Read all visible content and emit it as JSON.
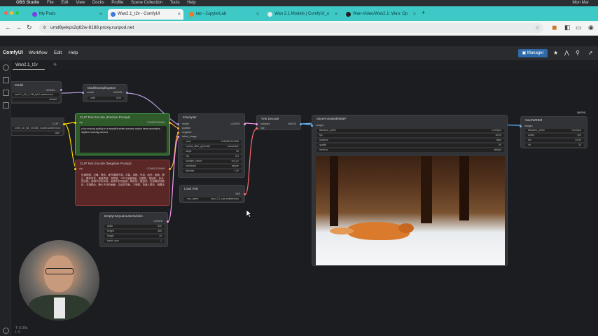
{
  "menubar": {
    "app": "OBS Studio",
    "items": [
      "File",
      "Edit",
      "View",
      "Docks",
      "Profile",
      "Scene Collection",
      "Tools",
      "Help"
    ],
    "clock": "Mon Mar"
  },
  "browser": {
    "tabs": [
      {
        "label": "My Pods",
        "active": false
      },
      {
        "label": "Wan2.1_t2v - ComfyUI",
        "active": true
      },
      {
        "label": "lab - JupyterLab",
        "active": false
      },
      {
        "label": "Wan 2.1 Models | ComfyUI_o",
        "active": false
      },
      {
        "label": "Wan-Video/Wan2.1: Wan: Op",
        "active": false
      }
    ],
    "new_tab": "+",
    "url": "umd8yekps2q62w-8188.proxy.runpod.net"
  },
  "comfy": {
    "logo": "ComfyUI",
    "menu": [
      "Workflow",
      "Edit",
      "Help"
    ],
    "manager_label": "Manager",
    "workflow_tab": "Wan2.1_t2v",
    "add_tab": "+"
  },
  "nodes": {
    "model_loader": {
      "title": "Model",
      "widget": "wan2.1_t2v_1.3B_fp16.safetensors",
      "dtype": "default",
      "out": "MODEL"
    },
    "sampling": {
      "title": "ModelSamplingSD3",
      "in": "model",
      "out": "MODEL",
      "shift_label": "shift",
      "shift_value": "8.00"
    },
    "clip_loader": {
      "title": "CLIP",
      "widget": "umt5_xxl_fp8_e4m3fn_scaled.safetensors",
      "type": "wan",
      "out": "CLIP"
    },
    "pos_prompt": {
      "title": "CLIP Text Encode (Positive Prompt)",
      "in": "clip",
      "out": "CONDITIONING",
      "text": "a fox moving quickly in a beautiful winter scenery nature trees mountains daytime tracking camera"
    },
    "neg_prompt": {
      "title": "CLIP Text Encode (Negative Prompt)",
      "in": "clip",
      "out": "CONDITIONING",
      "text": "色调艳丽，过曝，静态，细节模糊不清，字幕，风格，作品，画作，画面，静止，整体发灰，最差质量，低质量，JPEG压缩残留，丑陋的，残缺的，多余的手指，画得不好的手部，画得不好的脸部，畸形的，毁容的，形态畸形的肢体，手指融合，静止不动的画面，杂乱的背景，三条腿，背景人很多，倒着走"
    },
    "ksampler": {
      "title": "KSampler",
      "inputs": [
        "model",
        "positive",
        "negative",
        "latent_image"
      ],
      "out": "LATENT",
      "widgets": [
        {
          "label": "seed",
          "value": "1082826144288"
        },
        {
          "label": "control_after_generate",
          "value": "randomize"
        },
        {
          "label": "steps",
          "value": "30"
        },
        {
          "label": "cfg",
          "value": "6.0"
        },
        {
          "label": "sampler_name",
          "value": "uni_pc"
        },
        {
          "label": "scheduler",
          "value": "simple"
        },
        {
          "label": "denoise",
          "value": "1.00"
        }
      ]
    },
    "vae_decode": {
      "title": "VAE Decode",
      "inputs": [
        "samples",
        "vae"
      ],
      "out": "IMAGE"
    },
    "load_vae": {
      "title": "Load VAE",
      "out": "VAE",
      "widget_label": "vae_name",
      "widget_value": "wan_2.1_vae.safetensors"
    },
    "empty_latent": {
      "title": "EmptyHunyuanLatentVideo",
      "out": "LATENT",
      "widgets": [
        {
          "label": "width",
          "value": "832"
        },
        {
          "label": "height",
          "value": "480"
        },
        {
          "label": "length",
          "value": "33"
        },
        {
          "label": "batch_size",
          "value": "1"
        }
      ]
    },
    "save_animated": {
      "title": "SaveAnimatedWEBP",
      "in": "images",
      "widgets": [
        {
          "label": "filename_prefix",
          "value": "ComfyUI"
        },
        {
          "label": "fps",
          "value": "16.00"
        },
        {
          "label": "lossless",
          "value": "false"
        },
        {
          "label": "quality",
          "value": "90"
        },
        {
          "label": "method",
          "value": "default"
        }
      ]
    },
    "save_webm": {
      "title": "SaveWEBM",
      "badge": "[NEW]",
      "in": "images",
      "widgets": [
        {
          "label": "filename_prefix",
          "value": "ComfyUI"
        },
        {
          "label": "codec",
          "value": "vp9"
        },
        {
          "label": "fps",
          "value": "24.00"
        },
        {
          "label": "crf",
          "value": "32"
        }
      ]
    }
  },
  "status": {
    "line1": "T: 0.00s",
    "line2": "I: 0"
  },
  "colors": {
    "tabbar": "#3ec8c6",
    "positive_node": "#2f5a2a",
    "negative_node": "#5a2626",
    "manager": "#2f6aa8",
    "link_latent": "#ff9cf9",
    "link_conditioning": "#ffa931",
    "link_model": "#b39ddb"
  },
  "icons": [
    "obs-icon",
    "github-icon",
    "back-icon",
    "forward-icon",
    "reload-icon",
    "bookmark-icon",
    "extension-icon",
    "settings-icon"
  ]
}
